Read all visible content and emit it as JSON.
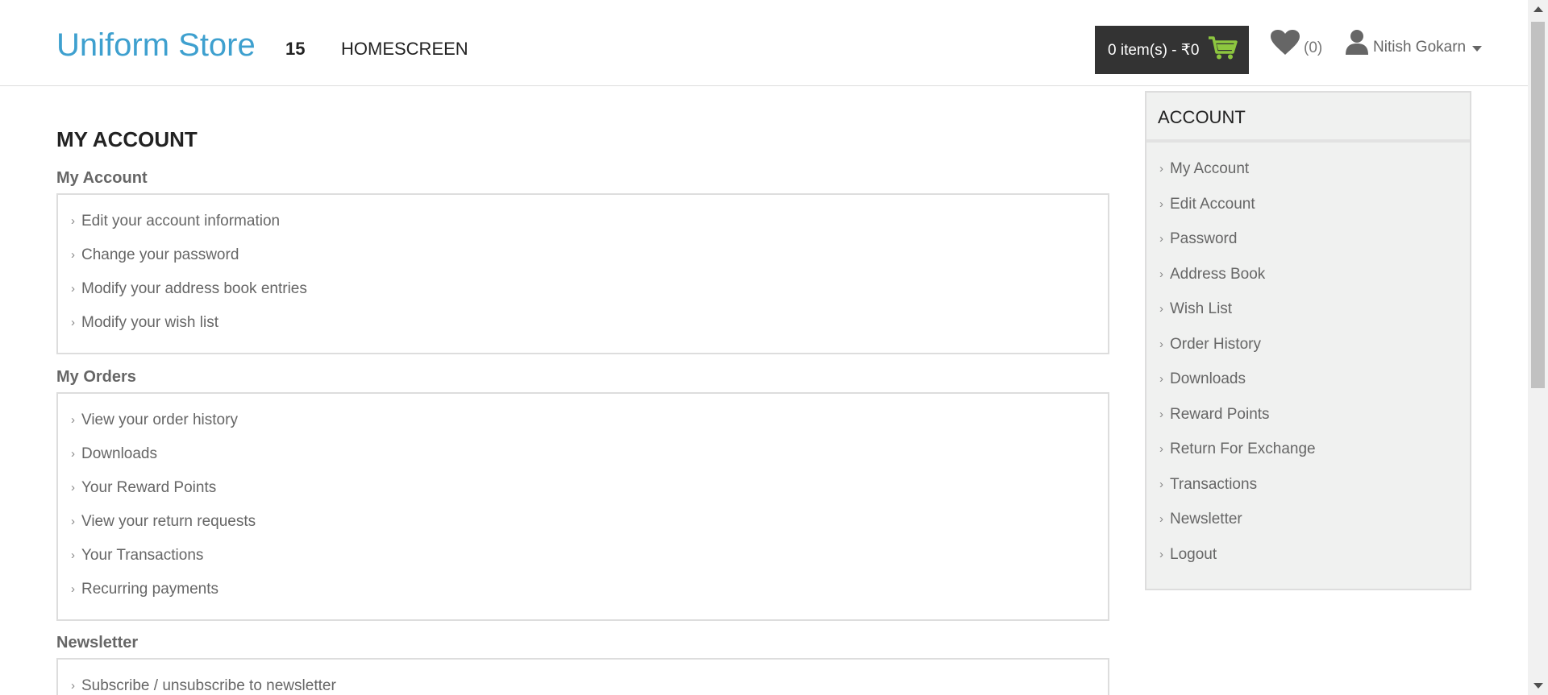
{
  "header": {
    "logo": "Uniform Store",
    "nav_number": "15",
    "nav_home": "HOMESCREEN",
    "cart_label": "0 item(s) - ₹0",
    "wishlist_count": "(0)",
    "user_name": "Nitish Gokarn"
  },
  "colors": {
    "brand": "#3ea0cf",
    "cart_bg": "#333333",
    "cart_icon": "#8dc63f"
  },
  "main": {
    "page_title": "MY ACCOUNT",
    "sections": [
      {
        "title": "My Account",
        "links": [
          "Edit your account information",
          "Change your password",
          "Modify your address book entries",
          "Modify your wish list"
        ]
      },
      {
        "title": "My Orders",
        "links": [
          "View your order history",
          "Downloads",
          "Your Reward Points",
          "View your return requests",
          "Your Transactions",
          "Recurring payments"
        ]
      },
      {
        "title": "Newsletter",
        "links": [
          "Subscribe / unsubscribe to newsletter"
        ]
      }
    ]
  },
  "sidebar": {
    "title": "ACCOUNT",
    "items": [
      "My Account",
      "Edit Account",
      "Password",
      "Address Book",
      "Wish List",
      "Order History",
      "Downloads",
      "Reward Points",
      "Return For Exchange",
      "Transactions",
      "Newsletter",
      "Logout"
    ]
  }
}
